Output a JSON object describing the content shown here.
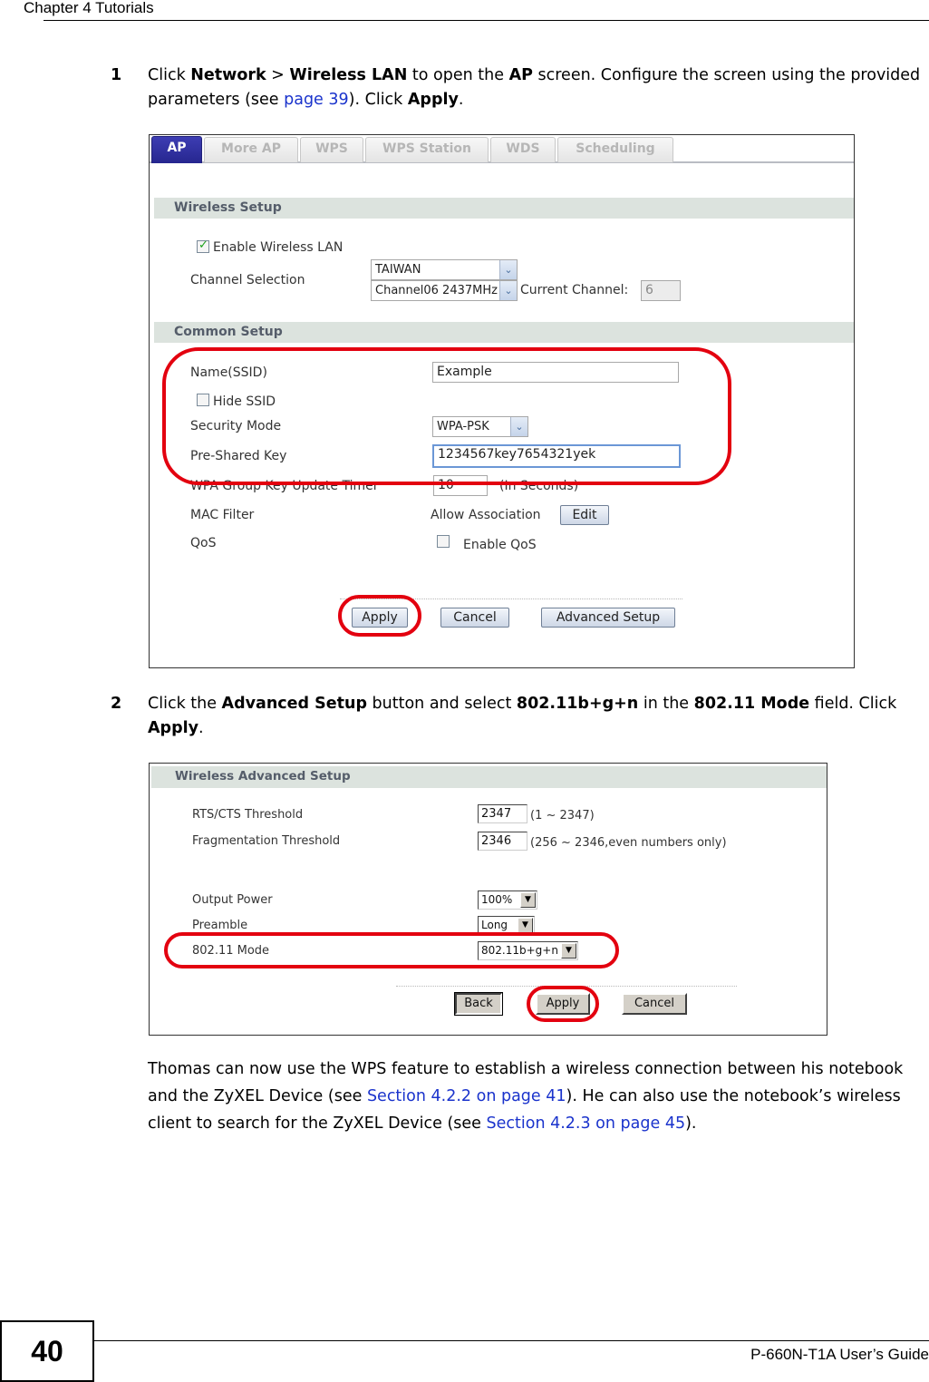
{
  "header": {
    "chapter": "Chapter 4 Tutorials"
  },
  "steps": [
    {
      "number": "1",
      "parts": {
        "t1": "Click ",
        "b1": "Network",
        "t2": " > ",
        "b2": "Wireless LAN",
        "t3": " to open the ",
        "b3": "AP",
        "t4": " screen. Configure the screen using the provided parameters (see ",
        "link": "page 39",
        "t5": "). Click ",
        "b4": "Apply",
        "t6": "."
      }
    },
    {
      "number": "2",
      "parts": {
        "t1": "Click the ",
        "b1": "Advanced Setup",
        "t2": " button and select ",
        "b2": "802.11b+g+n",
        "t3": " in the ",
        "b3": "802.11 Mode",
        "t4": " field. Click ",
        "b4": "Apply",
        "t5": "."
      }
    }
  ],
  "ap_screen": {
    "tabs": [
      "AP",
      "More AP",
      "WPS",
      "WPS Station",
      "WDS",
      "Scheduling"
    ],
    "active_tab": "AP",
    "wireless_setup": {
      "title": "Wireless Setup",
      "enable_wireless_label": "Enable Wireless LAN",
      "enable_wireless_checked": true,
      "channel_selection_label": "Channel Selection",
      "country": "TAIWAN",
      "channel": "Channel06 2437MHz",
      "current_channel_label": "Current Channel:",
      "current_channel": "6"
    },
    "common_setup": {
      "title": "Common Setup",
      "ssid_label": "Name(SSID)",
      "ssid": "Example",
      "hide_ssid_label": "Hide SSID",
      "hide_ssid_checked": false,
      "security_mode_label": "Security Mode",
      "security_mode": "WPA-PSK",
      "psk_label": "Pre-Shared Key",
      "psk": "1234567key7654321yek",
      "group_key_label": "WPA Group Key Update Timer",
      "group_key_value": "10",
      "group_key_unit": "(In Seconds)",
      "mac_filter_label": "MAC Filter",
      "mac_filter_value": "Allow Association",
      "edit_label": "Edit",
      "qos_label": "QoS",
      "qos_checkbox_label": "Enable QoS",
      "qos_checked": false
    },
    "buttons": {
      "apply": "Apply",
      "cancel": "Cancel",
      "advanced": "Advanced Setup"
    }
  },
  "advanced_screen": {
    "title": "Wireless Advanced Setup",
    "rts_label": "RTS/CTS  Threshold",
    "rts_value": "2347",
    "rts_range": "(1 ~ 2347)",
    "frag_label": "Fragmentation  Threshold",
    "frag_value": "2346",
    "frag_range": "(256 ~ 2346,even numbers only)",
    "power_label": "Output Power",
    "power_value": "100%",
    "preamble_label": "Preamble",
    "preamble_value": "Long",
    "mode_label": "802.11 Mode",
    "mode_value": "802.11b+g+n",
    "buttons": {
      "back": "Back",
      "apply": "Apply",
      "cancel": "Cancel"
    }
  },
  "closing": {
    "t1": "Thomas can now use the WPS feature to establish a wireless connection between his notebook and the ZyXEL Device (see ",
    "link1": "Section 4.2.2 on page 41",
    "t2": "). He can also use the notebook’s wireless client to search for the ZyXEL Device (see ",
    "link2": "Section 4.2.3 on page 45",
    "t3": ")."
  },
  "footer": {
    "page_number": "40",
    "guide_title": "P-660N-T1A User’s Guide"
  },
  "icons": {
    "dropdown": "▼",
    "dropdown_chevron": "⌄"
  },
  "colors": {
    "link": "#1a33cc",
    "highlight_ring": "#e3000f",
    "active_tab": "#2b2b99"
  }
}
